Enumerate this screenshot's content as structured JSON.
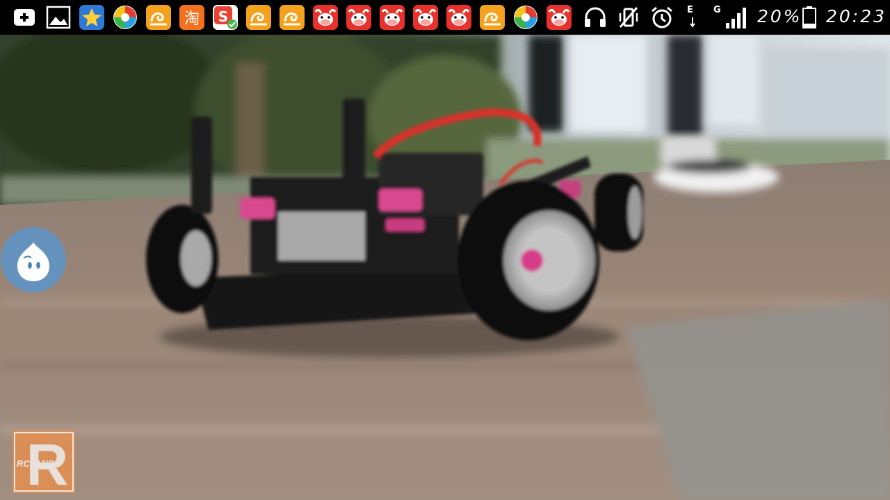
{
  "status_bar": {
    "notification_icons": [
      "add-icon",
      "gallery-icon",
      "star-app-icon",
      "pinwheel-app-icon",
      "uc-browser-icon",
      "taobao-icon",
      "sogou-input-icon",
      "uc-browser-icon",
      "uc-browser-icon",
      "cow-app-icon",
      "cow-app-icon",
      "cow-app-icon",
      "cow-app-icon",
      "cow-app-icon",
      "uc-browser-icon",
      "pinwheel-app-icon",
      "cow-app-icon"
    ],
    "taobao_glyph": "淘",
    "sogou_glyph": "S",
    "network_type": "E",
    "network_type_2": "G",
    "battery_percent": "20%",
    "time": "20:23"
  },
  "watermark": {
    "label": "RCFANS",
    "letter": "R"
  },
  "colors": {
    "status_bar_bg": "#000000",
    "float_button": "#5a96cd",
    "uc_orange": "#f4a11d",
    "cow_red": "#e5322d",
    "taobao_orange": "#f3711d"
  }
}
